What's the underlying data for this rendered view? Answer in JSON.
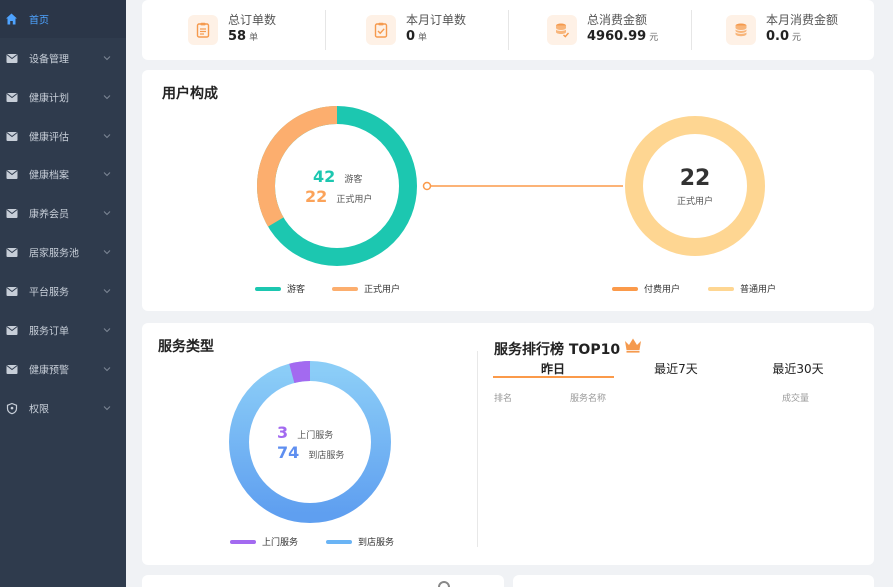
{
  "sidebar": {
    "items": [
      {
        "label": "首页",
        "icon": "home-icon",
        "active": true,
        "has_children": false
      },
      {
        "label": "设备管理",
        "icon": "mail-icon",
        "active": false,
        "has_children": true
      },
      {
        "label": "健康计划",
        "icon": "mail-icon",
        "active": false,
        "has_children": true
      },
      {
        "label": "健康评估",
        "icon": "mail-icon",
        "active": false,
        "has_children": true
      },
      {
        "label": "健康档案",
        "icon": "mail-icon",
        "active": false,
        "has_children": true
      },
      {
        "label": "康养会员",
        "icon": "mail-icon",
        "active": false,
        "has_children": true
      },
      {
        "label": "居家服务池",
        "icon": "mail-icon",
        "active": false,
        "has_children": true
      },
      {
        "label": "平台服务",
        "icon": "mail-icon",
        "active": false,
        "has_children": true
      },
      {
        "label": "服务订单",
        "icon": "mail-icon",
        "active": false,
        "has_children": true
      },
      {
        "label": "健康预警",
        "icon": "mail-icon",
        "active": false,
        "has_children": true
      },
      {
        "label": "权限",
        "icon": "shield-icon",
        "active": false,
        "has_children": true
      }
    ]
  },
  "stats": [
    {
      "label": "总订单数",
      "value": "58",
      "unit": "单",
      "icon": "clipboard-icon"
    },
    {
      "label": "本月订单数",
      "value": "0",
      "unit": "单",
      "icon": "checklist-icon"
    },
    {
      "label": "总消费金额",
      "value": "4960.99",
      "unit": "元",
      "icon": "coins-icon"
    },
    {
      "label": "本月消费金额",
      "value": "0.0",
      "unit": "元",
      "icon": "coins-stack-icon"
    }
  ],
  "user_composition": {
    "title": "用户构成",
    "left_ring": {
      "visitors_count": "42",
      "visitors_label": "游客",
      "formal_count": "22",
      "formal_label": "正式用户"
    },
    "right_ring": {
      "count": "22",
      "label": "正式用户"
    },
    "legend_left": [
      {
        "label": "游客",
        "color": "#1cc7b0"
      },
      {
        "label": "正式用户",
        "color": "#fba35a"
      }
    ],
    "legend_right": [
      {
        "label": "付费用户",
        "color": "#fb9a4a"
      },
      {
        "label": "普通用户",
        "color": "#fcd68a"
      }
    ]
  },
  "service_types": {
    "title": "服务类型",
    "door_count": "3",
    "door_label": "上门服务",
    "store_count": "74",
    "store_label": "到店服务",
    "legend": [
      {
        "label": "上门服务",
        "color": "#a36af0"
      },
      {
        "label": "到店服务",
        "color": "#6ab4f5"
      }
    ]
  },
  "ranking": {
    "title": "服务排行榜 TOP10",
    "tabs": [
      "昨日",
      "最近7天",
      "最近30天"
    ],
    "columns": [
      "排名",
      "服务名称",
      "成交量"
    ]
  },
  "colors": {
    "sidebar_bg": "#2f3b4d",
    "accent_blue": "#4ea3ff",
    "teal": "#1cc7b0",
    "orange": "#fba35a",
    "light_orange": "#fcd68a",
    "purple": "#a36af0",
    "blue": "#6ab4f5"
  }
}
